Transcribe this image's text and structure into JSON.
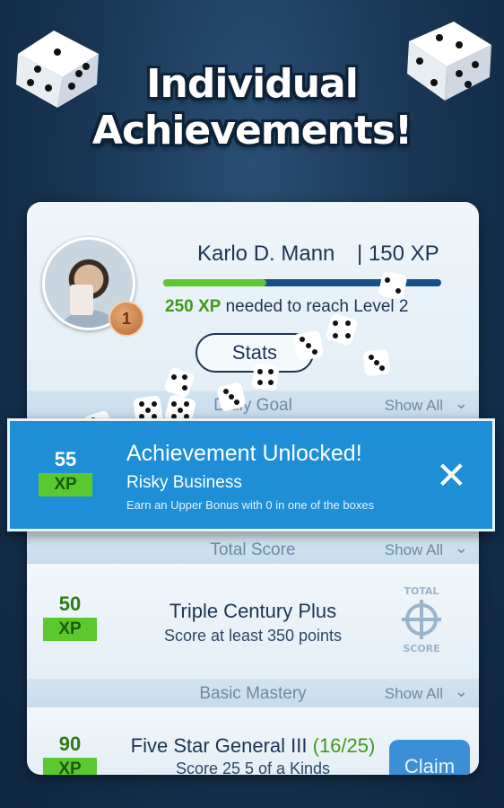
{
  "headline": {
    "line1": "Individual",
    "line2": "Achievements!"
  },
  "profile": {
    "player_name": "Karlo D. Mann",
    "xp_total": "| 150 XP",
    "level_badge": "1",
    "xp_needed_value": "250 XP",
    "xp_needed_text": " needed to reach Level 2",
    "progress_fraction": 0.37,
    "stats_label": "Stats"
  },
  "sections": [
    {
      "title": "Daily Goal",
      "show_all": "Show All"
    },
    {
      "title": "Total Score",
      "show_all": "Show All"
    },
    {
      "title": "Basic Mastery",
      "show_all": "Show All"
    }
  ],
  "toast": {
    "xp_value": "55",
    "xp_unit": "XP",
    "title": "Achievement Unlocked!",
    "name": "Risky Business",
    "description": "Earn an Upper Bonus with 0 in one of the boxes"
  },
  "achievements": [
    {
      "xp_value": "50",
      "xp_unit": "XP",
      "title": "Triple Century Plus",
      "description": "Score at least 350 points",
      "seal_top": "TOTAL",
      "seal_bottom": "SCORE"
    },
    {
      "xp_value": "90",
      "xp_unit": "XP",
      "title": "Five Star General III",
      "progress": "(16/25)",
      "description": "Score 25 5 of a Kinds",
      "claim_label": "Claim"
    }
  ],
  "colors": {
    "accent_green": "#5cc830",
    "toast_blue": "#1e8ed7",
    "claim_blue": "#3b8fd6",
    "text_navy": "#1d3553"
  }
}
